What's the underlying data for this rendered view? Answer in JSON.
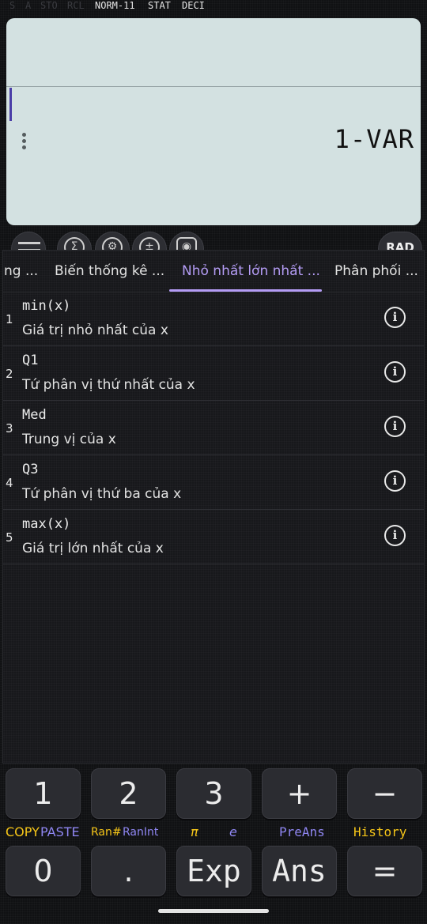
{
  "status": {
    "indicators": [
      {
        "text": "S",
        "on": false
      },
      {
        "text": "A",
        "on": false
      },
      {
        "text": "STO",
        "on": false
      },
      {
        "text": "RCL",
        "on": false
      },
      {
        "text": "NORM-11",
        "on": true
      },
      {
        "text": "STAT",
        "on": true
      },
      {
        "text": "DECI",
        "on": true
      }
    ]
  },
  "display": {
    "input": "",
    "result": "1-VAR"
  },
  "toolbar": {
    "menu_icon": "menu-icon",
    "sigma_icon": "sum-icon",
    "settings_icon": "gear-icon",
    "plus_minus_icon": "plus-minus-icon",
    "camera_icon": "camera-icon",
    "angle_mode": "RAD"
  },
  "tabs": [
    {
      "label": "ng ...",
      "active": false
    },
    {
      "label": "Biến thống kê ...",
      "active": false
    },
    {
      "label": "Nhỏ nhất lớn nhất ...",
      "active": true
    },
    {
      "label": "Phân phối ...",
      "active": false
    }
  ],
  "items": [
    {
      "num": "1",
      "name": "min(x)",
      "desc": "Giá trị nhỏ nhất của x"
    },
    {
      "num": "2",
      "name": "Q1",
      "desc": "Tứ phân vị thứ nhất của x"
    },
    {
      "num": "3",
      "name": "Med",
      "desc": "Trung vị của x"
    },
    {
      "num": "4",
      "name": "Q3",
      "desc": "Tứ phân vị thứ ba của x"
    },
    {
      "num": "5",
      "name": "max(x)",
      "desc": "Giá trị lớn nhất của x"
    }
  ],
  "info_glyph": "i",
  "keys_row1": [
    "1",
    "2",
    "3",
    "+",
    "−"
  ],
  "shift_labels": {
    "copy": "COPY",
    "paste": "PASTE",
    "ran": "Ran#",
    "ranint": "RanInt",
    "pi": "π",
    "e": "e",
    "preans": "PreAns",
    "history": "History"
  },
  "keys_row2": [
    "0",
    ".",
    "Exp",
    "Ans",
    "="
  ],
  "colors": {
    "accent": "#b49cf5",
    "shift_yellow": "#f5c518",
    "shift_blue": "#8f86f2",
    "display_bg": "#d3e1e1"
  }
}
